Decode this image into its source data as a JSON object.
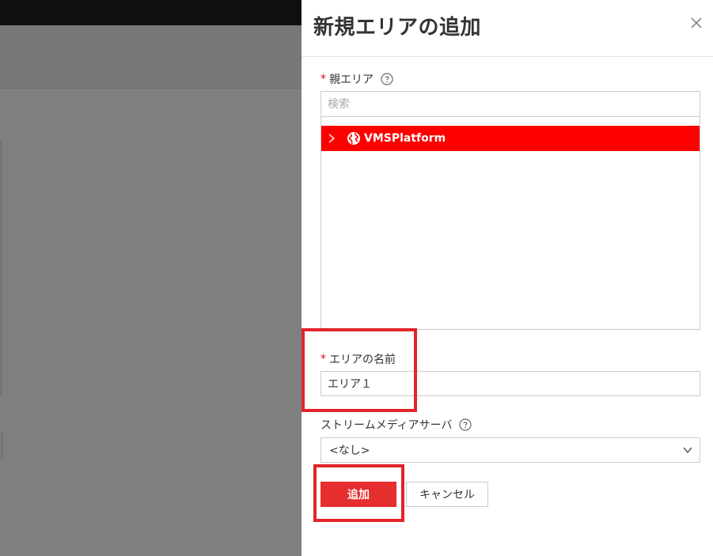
{
  "drawer": {
    "title": "新規エリアの追加",
    "parent_area": {
      "label": "親エリア",
      "required_mark": "*",
      "search_placeholder": "検索",
      "tree_node_label": "VMSPlatform"
    },
    "area_name": {
      "label": "エリアの名前",
      "required_mark": "*",
      "value": "エリア１"
    },
    "stream_media_server": {
      "label": "ストリームメディアサーバ",
      "selected": "<なし>"
    },
    "buttons": {
      "add": "追加",
      "cancel": "キャンセル"
    }
  },
  "colors": {
    "accent": "#ff0000",
    "primary_button": "#e62e2e",
    "required": "#e3001b",
    "highlight": "#e3242b"
  }
}
